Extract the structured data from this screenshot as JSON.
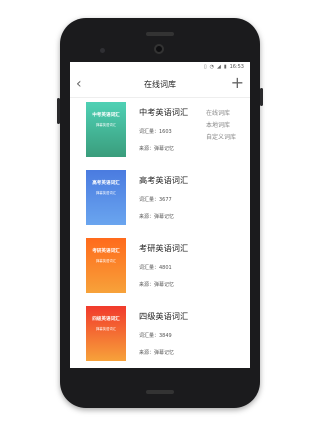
{
  "status_bar": {
    "icons": [
      "vibrate-icon",
      "wifi-icon",
      "signal-icon",
      "battery-icon"
    ],
    "time": "16:53"
  },
  "header": {
    "back_icon": "‹",
    "title": "在线词库",
    "add_icon": "+"
  },
  "menu": {
    "items": [
      "在线词库",
      "本地词库",
      "自定义词库"
    ]
  },
  "books": [
    {
      "name": "中考英语词汇",
      "count": "词汇量：1603",
      "source": "来源：弹幕记忆",
      "cover_title": "中考英语词汇",
      "cover_sub": "弹幕英语词汇",
      "color_top": "#4fd1b5",
      "color_bottom": "#3a9d7c"
    },
    {
      "name": "高考英语词汇",
      "count": "词汇量：3677",
      "source": "来源：弹幕记忆",
      "cover_title": "高考英语词汇",
      "cover_sub": "弹幕英语词汇",
      "color_top": "#4a7be0",
      "color_bottom": "#6aa5ef"
    },
    {
      "name": "考研英语词汇",
      "count": "词汇量：4801",
      "source": "来源：弹幕记忆",
      "cover_title": "考研英语词汇",
      "cover_sub": "弹幕英语词汇",
      "color_top": "#ff6a1c",
      "color_bottom": "#f7a23a"
    },
    {
      "name": "四级英语词汇",
      "count": "词汇量：3849",
      "source": "来源：弹幕记忆",
      "cover_title": "四级英语词汇",
      "cover_sub": "弹幕英语词汇",
      "color_top": "#f13a2c",
      "color_bottom": "#f7a23a"
    }
  ]
}
